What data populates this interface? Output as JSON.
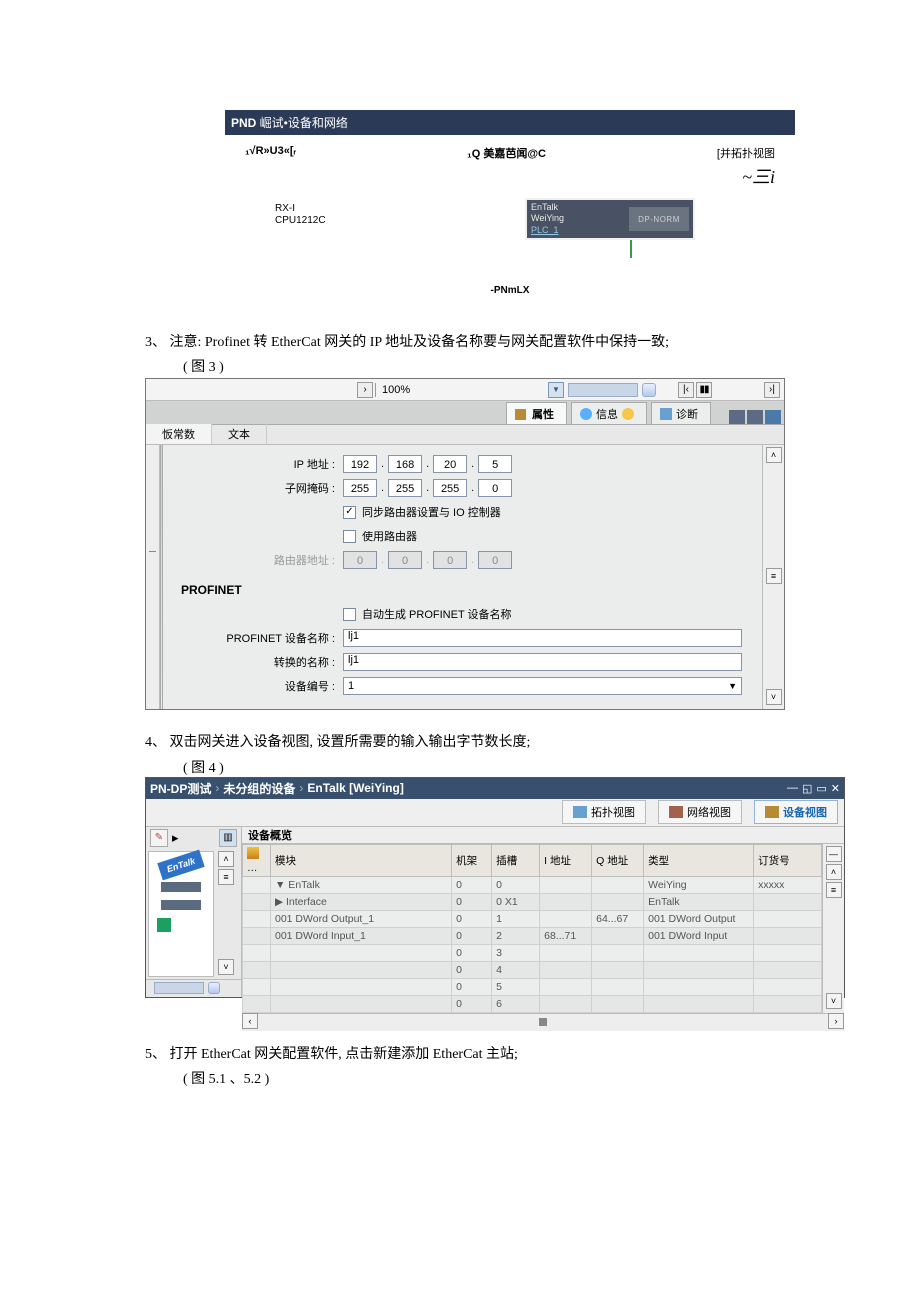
{
  "fig2": {
    "title_prefix": "PND",
    "title_rest": " 崛试•设备和网络",
    "top_left": "₁√R»U3«[ᵣ",
    "top_mid": "₁Q 美嘉芭闻@C",
    "top_right_label": "[并拓扑视图",
    "top_right_sym": "~三i",
    "plc_line1": "RX-I",
    "plc_line2": "CPU1212C",
    "gw_line1": "EnTalk",
    "gw_line2": "WeiYing",
    "gw_link": "PLC_1",
    "dp_norm": "DP-NORM",
    "footer": "-PNmLX"
  },
  "para3": "3、 注意: Profinet 转 EtherCat 网关的 IP 地址及设备名称要与网关配置软件中保持一致; ",
  "para3_sub": "( 图 3 )",
  "fig3": {
    "zoom": "100%",
    "tabs": {
      "prop": "属性",
      "info": "信息",
      "diag": "诊断"
    },
    "subtabs": {
      "const": "㤆常数",
      "text": "文本"
    },
    "labels": {
      "ip": "IP 地址 :",
      "mask": "子网掩码 :",
      "sync": "同步路由器设置与 IO 控制器",
      "router": "使用路由器",
      "router_addr": "路由器地址 :",
      "section": "PROFINET",
      "autogen": "自动生成 PROFINET 设备名称",
      "pn_name": "PROFINET 设备名称 :",
      "conv_name": "转换的名称 :",
      "dev_no": "设备编号 :"
    },
    "ip": [
      "192",
      "168",
      "20",
      "5"
    ],
    "mask": [
      "255",
      "255",
      "255",
      "0"
    ],
    "router_ip": [
      "0",
      "0",
      "0",
      "0"
    ],
    "sync_on": true,
    "router_on": false,
    "autogen_on": false,
    "pn_name_val": "lj1",
    "conv_name_val": "lj1",
    "dev_no_val": "1"
  },
  "para4": "4、 双击网关进入设备视图, 设置所需要的输入输出字节数长度; ",
  "para4_sub": "( 图 4 )",
  "fig4": {
    "crumb": [
      "PN-DP测试",
      "未分组的设备",
      "EnTalk [WeiYing]"
    ],
    "views": {
      "topo": "拓扑视图",
      "net": "网络视图",
      "dev": "设备视图"
    },
    "dev_overview": "设备概览",
    "thumb_label": "EnTalk",
    "cols": [
      "模块",
      "机架",
      "插槽",
      "I 地址",
      "Q 地址",
      "类型",
      "订货号"
    ],
    "rows": [
      {
        "m": "▼  EnTalk",
        "rack": "0",
        "slot": "0",
        "ia": "",
        "qa": "",
        "type": "WeiYing",
        "order": "xxxxx"
      },
      {
        "m": "   ▶  Interface",
        "rack": "0",
        "slot": "0 X1",
        "ia": "",
        "qa": "",
        "type": "EnTalk",
        "order": ""
      },
      {
        "m": "   001 DWord Output_1",
        "rack": "0",
        "slot": "1",
        "ia": "",
        "qa": "64...67",
        "type": "001 DWord Output",
        "order": ""
      },
      {
        "m": "   001 DWord Input_1",
        "rack": "0",
        "slot": "2",
        "ia": "68...71",
        "qa": "",
        "type": "001 DWord Input",
        "order": ""
      },
      {
        "m": "",
        "rack": "0",
        "slot": "3",
        "ia": "",
        "qa": "",
        "type": "",
        "order": ""
      },
      {
        "m": "",
        "rack": "0",
        "slot": "4",
        "ia": "",
        "qa": "",
        "type": "",
        "order": ""
      },
      {
        "m": "",
        "rack": "0",
        "slot": "5",
        "ia": "",
        "qa": "",
        "type": "",
        "order": ""
      },
      {
        "m": "",
        "rack": "0",
        "slot": "6",
        "ia": "",
        "qa": "",
        "type": "",
        "order": ""
      }
    ]
  },
  "para5": "5、 打开 EtherCat 网关配置软件, 点击新建添加 EtherCat 主站; ",
  "para5_sub": "( 图 5.1 、5.2 )"
}
